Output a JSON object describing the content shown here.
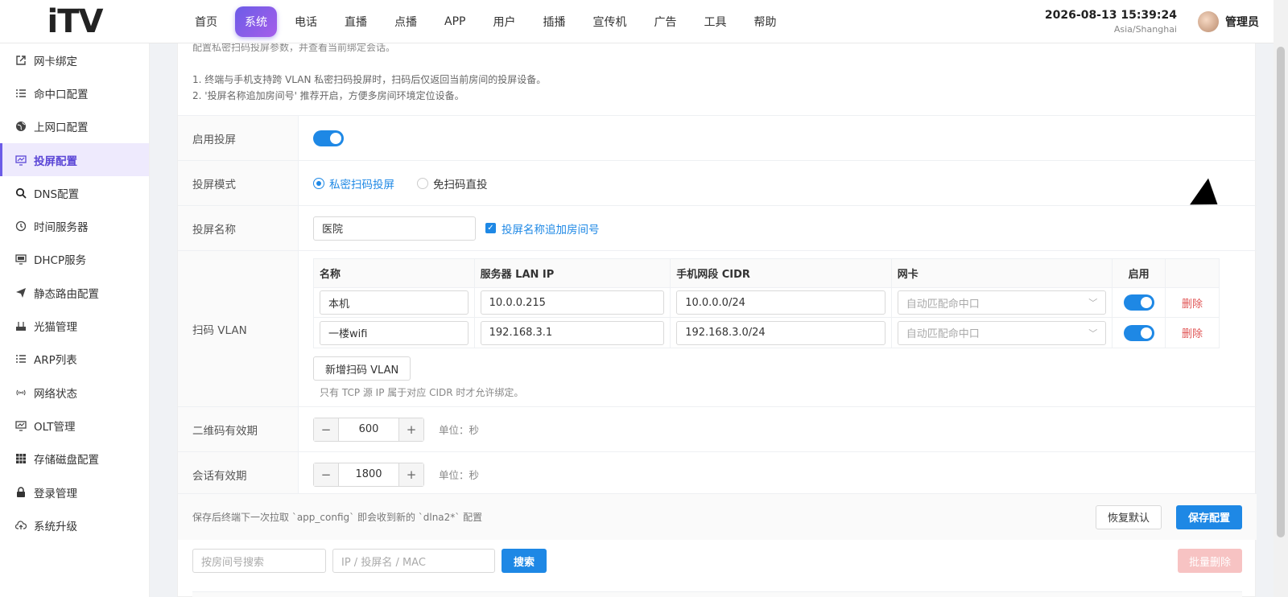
{
  "header": {
    "logo_text": "iTV",
    "nav": [
      "首页",
      "系统",
      "电话",
      "直播",
      "点播",
      "APP",
      "用户",
      "插播",
      "宣传机",
      "广告",
      "工具",
      "帮助"
    ],
    "active_nav": "系统",
    "datetime": "2026-08-13 15:39:24",
    "timezone": "Asia/Shanghai",
    "user": "管理员"
  },
  "sidebar": {
    "items": [
      {
        "label": "网卡绑定",
        "icon": "external-link-icon"
      },
      {
        "label": "命中口配置",
        "icon": "list-icon"
      },
      {
        "label": "上网口配置",
        "icon": "globe-icon"
      },
      {
        "label": "投屏配置",
        "icon": "monitor-icon",
        "active": true
      },
      {
        "label": "DNS配置",
        "icon": "search-icon"
      },
      {
        "label": "时间服务器",
        "icon": "clock-icon"
      },
      {
        "label": "DHCP服务",
        "icon": "screen-icon"
      },
      {
        "label": "静态路由配置",
        "icon": "paper-plane-icon"
      },
      {
        "label": "光猫管理",
        "icon": "modem-icon"
      },
      {
        "label": "ARP列表",
        "icon": "list-icon"
      },
      {
        "label": "网络状态",
        "icon": "signal-icon"
      },
      {
        "label": "OLT管理",
        "icon": "chart-icon"
      },
      {
        "label": "存储磁盘配置",
        "icon": "grid-icon"
      },
      {
        "label": "登录管理",
        "icon": "lock-icon"
      },
      {
        "label": "系统升级",
        "icon": "cloud-upload-icon"
      }
    ]
  },
  "desc": {
    "top": "配置私密扫码投屏参数，并查看当前绑定会话。",
    "line1": "1. 终端与手机支持跨 VLAN 私密扫码投屏时，扫码后仅返回当前房间的投屏设备。",
    "line2": "2. '投屏名称追加房间号' 推荐开启，方便多房间环境定位设备。"
  },
  "form": {
    "enable_label": "启用投屏",
    "mode_label": "投屏模式",
    "mode_opt1": "私密扫码投屏",
    "mode_opt2": "免扫码直投",
    "name_label": "投屏名称",
    "name_value": "医院",
    "name_checkbox": "投屏名称追加房间号",
    "vlan_label": "扫码 VLAN",
    "vlan_headers": [
      "名称",
      "服务器 LAN IP",
      "手机网段 CIDR",
      "网卡",
      "启用",
      ""
    ],
    "vlan_rows": [
      {
        "name": "本机",
        "ip": "10.0.0.215",
        "cidr": "10.0.0.0/24",
        "nic": "自动匹配命中口",
        "del": "删除"
      },
      {
        "name": "一楼wifi",
        "ip": "192.168.3.1",
        "cidr": "192.168.3.0/24",
        "nic": "自动匹配命中口",
        "del": "删除"
      }
    ],
    "add_vlan": "新增扫码 VLAN",
    "vlan_hint": "只有 TCP 源 IP 属于对应 CIDR 时才允许绑定。",
    "qr_label": "二维码有效期",
    "qr_value": "600",
    "session_label": "会话有效期",
    "session_value": "1800",
    "unit": "单位：秒"
  },
  "footer": {
    "note": "保存后终端下一次拉取 `app_config` 即会收到新的 `dlna2*` 配置",
    "reset": "恢复默认",
    "save": "保存配置"
  },
  "search": {
    "room_ph": "按房间号搜索",
    "ip_ph": "IP / 投屏名 / MAC",
    "search_btn": "搜索",
    "batch_delete": "批量删除"
  },
  "colors": {
    "primary": "#1e88e5",
    "accent": "#6c5ce7",
    "danger": "#e05555"
  }
}
